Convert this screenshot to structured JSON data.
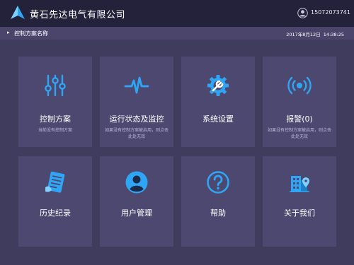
{
  "header": {
    "title": "黄石先达电气有限公司",
    "user_phone": "15072073741",
    "logo_icon": "triangle-logo-icon",
    "avatar_icon": "user-avatar-icon"
  },
  "subbar": {
    "arrow": "▸",
    "title": "控制方案名称",
    "datetime": "2017年8月12日  14:38:25"
  },
  "tiles": [
    {
      "label": "控制方案",
      "desc": "当前没有控制方案",
      "icon": "sliders-icon"
    },
    {
      "label": "运行状态及监控",
      "desc": "如果没有控制方案被启用，则点击此处无效",
      "icon": "pulse-icon"
    },
    {
      "label": "系统设置",
      "desc": "",
      "icon": "gear-wrench-icon"
    },
    {
      "label": "报警(0)",
      "desc": "如果没有控制方案被启用，则点击此处无效",
      "icon": "alarm-signal-icon"
    },
    {
      "label": "历史纪录",
      "desc": "",
      "icon": "document-list-icon"
    },
    {
      "label": "用户管理",
      "desc": "",
      "icon": "user-circle-icon"
    },
    {
      "label": "帮助",
      "desc": "",
      "icon": "help-icon"
    },
    {
      "label": "关于我们",
      "desc": "",
      "icon": "building-location-icon"
    }
  ],
  "colors": {
    "background": "#24213a",
    "subbar": "#4b456c",
    "main": "#403c5e",
    "tile": "#4d4870",
    "icon_blue": "#2fa6f5"
  }
}
